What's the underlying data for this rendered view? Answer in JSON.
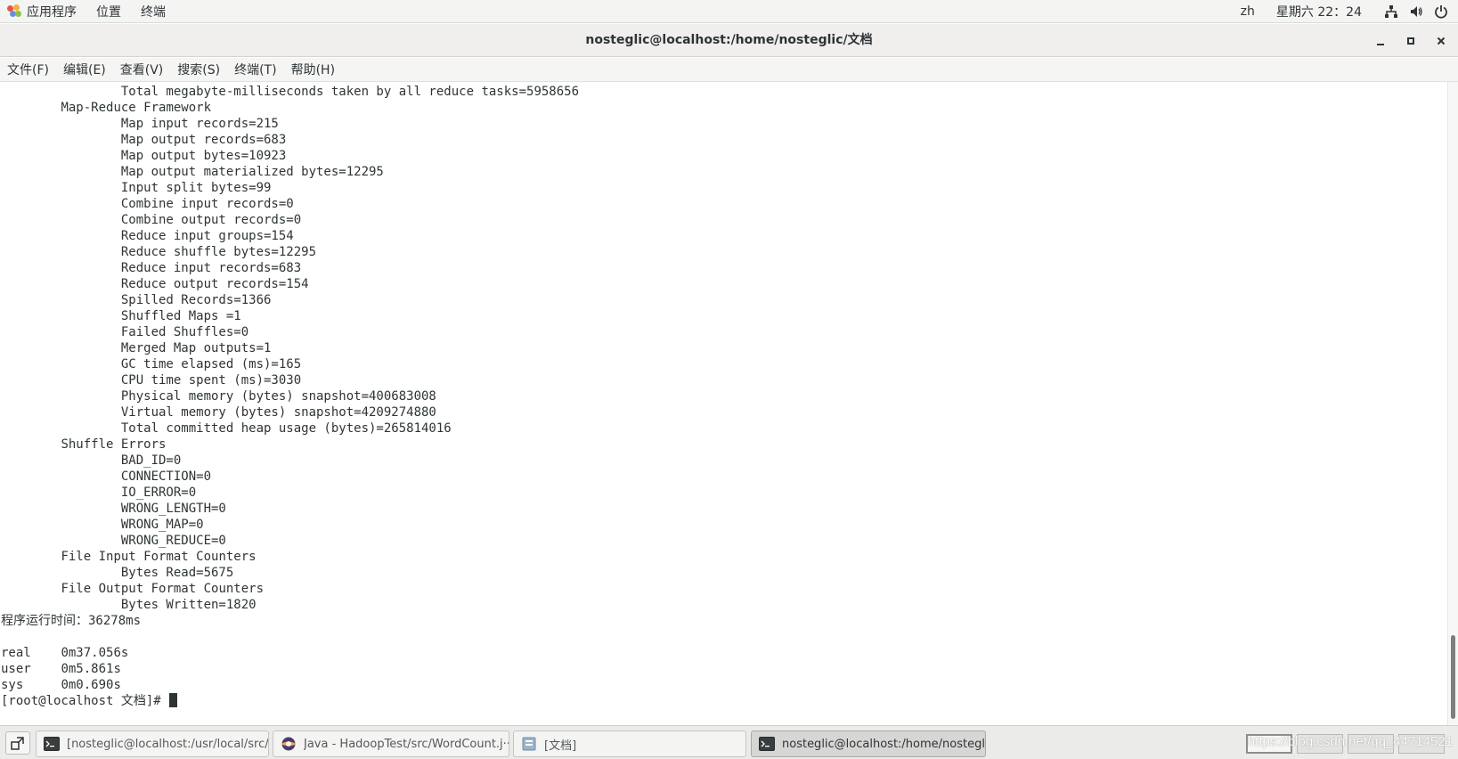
{
  "top_panel": {
    "applications": "应用程序",
    "places": "位置",
    "terminal": "终端",
    "language": "zh",
    "clock": "星期六 22：24",
    "tray_icons": [
      "network-icon",
      "volume-icon",
      "power-icon"
    ]
  },
  "window": {
    "title": "nosteglic@localhost:/home/nosteglic/文档",
    "buttons": [
      "minimize-icon",
      "maximize-icon",
      "close-icon"
    ]
  },
  "menu": {
    "file": "文件(F)",
    "edit": "编辑(E)",
    "view": "查看(V)",
    "search": "搜索(S)",
    "terminal": "终端(T)",
    "help": "帮助(H)"
  },
  "terminal": {
    "lines": [
      "\t\tTotal megabyte-milliseconds taken by all reduce tasks=5958656",
      "\tMap-Reduce Framework",
      "\t\tMap input records=215",
      "\t\tMap output records=683",
      "\t\tMap output bytes=10923",
      "\t\tMap output materialized bytes=12295",
      "\t\tInput split bytes=99",
      "\t\tCombine input records=0",
      "\t\tCombine output records=0",
      "\t\tReduce input groups=154",
      "\t\tReduce shuffle bytes=12295",
      "\t\tReduce input records=683",
      "\t\tReduce output records=154",
      "\t\tSpilled Records=1366",
      "\t\tShuffled Maps =1",
      "\t\tFailed Shuffles=0",
      "\t\tMerged Map outputs=1",
      "\t\tGC time elapsed (ms)=165",
      "\t\tCPU time spent (ms)=3030",
      "\t\tPhysical memory (bytes) snapshot=400683008",
      "\t\tVirtual memory (bytes) snapshot=4209274880",
      "\t\tTotal committed heap usage (bytes)=265814016",
      "\tShuffle Errors",
      "\t\tBAD_ID=0",
      "\t\tCONNECTION=0",
      "\t\tIO_ERROR=0",
      "\t\tWRONG_LENGTH=0",
      "\t\tWRONG_MAP=0",
      "\t\tWRONG_REDUCE=0",
      "\tFile Input Format Counters ",
      "\t\tBytes Read=5675",
      "\tFile Output Format Counters ",
      "\t\tBytes Written=1820",
      "程序运行时间：36278ms",
      "",
      "real\t0m37.056s",
      "user\t0m5.861s",
      "sys\t0m0.690s"
    ],
    "prompt": "[root@localhost 文档]# "
  },
  "scrollbar": {
    "thumb_start": 0.86,
    "thumb_size": 0.13
  },
  "taskbar": {
    "tasks": [
      {
        "label": "[nosteglic@localhost:/usr/local/src/···",
        "icon": "terminal-icon",
        "active": false
      },
      {
        "label": "Java - HadoopTest/src/WordCount.j···",
        "icon": "eclipse-icon",
        "active": false
      },
      {
        "label": "[文档]",
        "icon": "file-manager-icon",
        "active": false
      },
      {
        "label": "nosteglic@localhost:/home/nostegli···",
        "icon": "terminal-icon",
        "active": true
      }
    ],
    "watermark": "https://blog.csdn.net/qq_44714521"
  }
}
